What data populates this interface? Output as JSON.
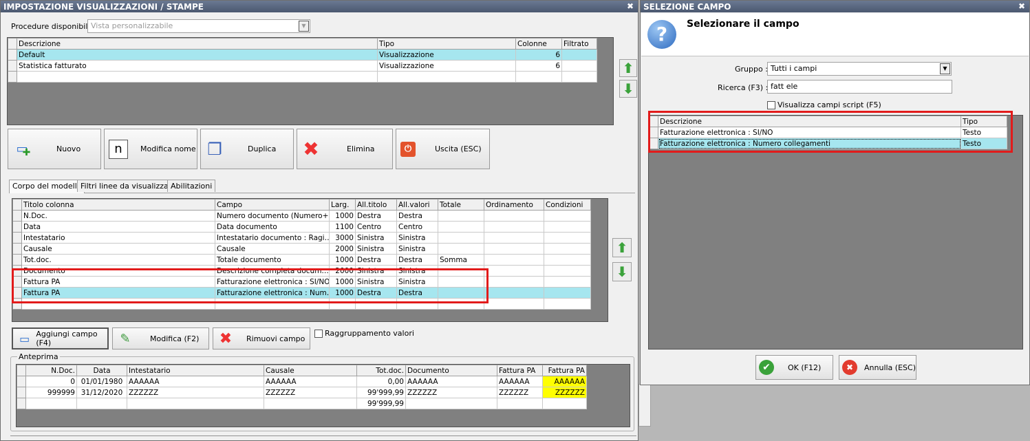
{
  "left": {
    "title": "IMPOSTAZIONE VISUALIZZAZIONI / STAMPE",
    "procedure_label": "Procedure disponibili :",
    "procedure_value": "Vista personalizzabile",
    "models": {
      "headers": [
        "Descrizione",
        "Tipo",
        "Colonne",
        "Filtrato"
      ],
      "rows": [
        [
          "Default",
          "Visualizzazione",
          "6",
          ""
        ],
        [
          "Statistica fatturato",
          "Visualizzazione",
          "6",
          ""
        ]
      ]
    },
    "buttons": {
      "nuovo": "Nuovo",
      "modifica_nome": "Modifica nome",
      "duplica": "Duplica",
      "elimina": "Elimina",
      "uscita": "Uscita (ESC)"
    },
    "tabs": [
      "Corpo del modello",
      "Filtri linee da visualizzare",
      "Abilitazioni"
    ],
    "columns": {
      "headers": [
        "Titolo colonna",
        "Campo",
        "Larg.",
        "All.titolo",
        "All.valori",
        "Totale",
        "Ordinamento",
        "Condizioni"
      ],
      "rows": [
        [
          "N.Doc.",
          "Numero documento (Numero+…",
          "1000",
          "Destra",
          "Destra",
          "",
          "",
          ""
        ],
        [
          "Data",
          "Data documento",
          "1100",
          "Centro",
          "Centro",
          "",
          "",
          ""
        ],
        [
          "Intestatario",
          "Intestatario documento : Ragi…",
          "3000",
          "Sinistra",
          "Sinistra",
          "",
          "",
          ""
        ],
        [
          "Causale",
          "Causale",
          "2000",
          "Sinistra",
          "Sinistra",
          "",
          "",
          ""
        ],
        [
          "Tot.doc.",
          "Totale documento",
          "1000",
          "Destra",
          "Destra",
          "Somma",
          "",
          ""
        ],
        [
          "Documento",
          "Descrizione completa docum…",
          "2000",
          "Sinistra",
          "Sinistra",
          "",
          "",
          ""
        ],
        [
          "Fattura PA",
          "Fatturazione elettronica : SI/NO",
          "1000",
          "Sinistra",
          "Sinistra",
          "",
          "",
          ""
        ],
        [
          "Fattura PA",
          "Fatturazione elettronica : Num…",
          "1000",
          "Destra",
          "Destra",
          "",
          "",
          ""
        ]
      ]
    },
    "field_buttons": {
      "aggiungi": "Aggiungi campo (F4)",
      "modifica": "Modifica (F2)",
      "rimuovi": "Rimuovi campo"
    },
    "raggruppamento": "Raggruppamento valori",
    "anteprima": {
      "label": "Anteprima",
      "headers": [
        "N.Doc.",
        "Data",
        "Intestatario",
        "Causale",
        "Tot.doc.",
        "Documento",
        "Fattura PA",
        "Fattura PA"
      ],
      "rows": [
        [
          "0",
          "01/01/1980",
          "AAAAAA",
          "AAAAAA",
          "0,00",
          "AAAAAA",
          "AAAAAA",
          "AAAAAA"
        ],
        [
          "999999",
          "31/12/2020",
          "ZZZZZZ",
          "ZZZZZZ",
          "99'999,99",
          "ZZZZZZ",
          "ZZZZZZ",
          "ZZZZZZ"
        ],
        [
          "",
          "",
          "",
          "",
          "99'999,99",
          "",
          "",
          ""
        ]
      ]
    }
  },
  "right": {
    "title": "SELEZIONE CAMPO",
    "heading": "Selezionare il campo",
    "gruppo_label": "Gruppo :",
    "gruppo_value": "Tutti i campi",
    "ricerca_label": "Ricerca (F3) :",
    "ricerca_value": "fatt ele",
    "script_label": "Visualizza campi script (F5)",
    "results": {
      "headers": [
        "Descrizione",
        "Tipo"
      ],
      "rows": [
        [
          "Fatturazione elettronica : SI/NO",
          "Testo"
        ],
        [
          "Fatturazione elettronica : Numero collegamenti",
          "Testo"
        ]
      ]
    },
    "ok": "OK (F12)",
    "annulla": "Annulla (ESC)"
  },
  "colors": {
    "selected_row": "#a6e6ef",
    "highlight_red": "#e21b1b",
    "preview_yellow": "#ffff00",
    "title_bar": "#5a6880"
  }
}
